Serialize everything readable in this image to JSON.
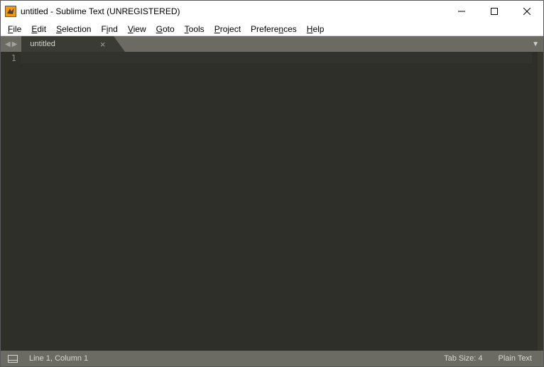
{
  "window": {
    "title": "untitled - Sublime Text (UNREGISTERED)"
  },
  "menu": {
    "file": {
      "label": "File",
      "mnemonic": "F"
    },
    "edit": {
      "label": "Edit",
      "mnemonic": "E"
    },
    "selection": {
      "label": "Selection",
      "mnemonic": "S"
    },
    "find": {
      "label": "Find",
      "mnemonic": "i"
    },
    "view": {
      "label": "View",
      "mnemonic": "V"
    },
    "goto": {
      "label": "Goto",
      "mnemonic": "G"
    },
    "tools": {
      "label": "Tools",
      "mnemonic": "T"
    },
    "project": {
      "label": "Project",
      "mnemonic": "P"
    },
    "preferences": {
      "label": "Preferences",
      "mnemonic": "n"
    },
    "help": {
      "label": "Help",
      "mnemonic": "H"
    }
  },
  "tabs": [
    {
      "label": "untitled",
      "active": true
    }
  ],
  "gutter": {
    "line1": "1"
  },
  "status": {
    "line_col": "Line 1, Column 1",
    "tab_size": "Tab Size: 4",
    "syntax": "Plain Text"
  },
  "colors": {
    "editor_bg": "#2f2f2a",
    "tabstrip_bg": "#6b6b63",
    "tab_active_bg": "#3b3b35",
    "statusbar_bg": "#6b6b63",
    "accent": "#ff9800"
  }
}
